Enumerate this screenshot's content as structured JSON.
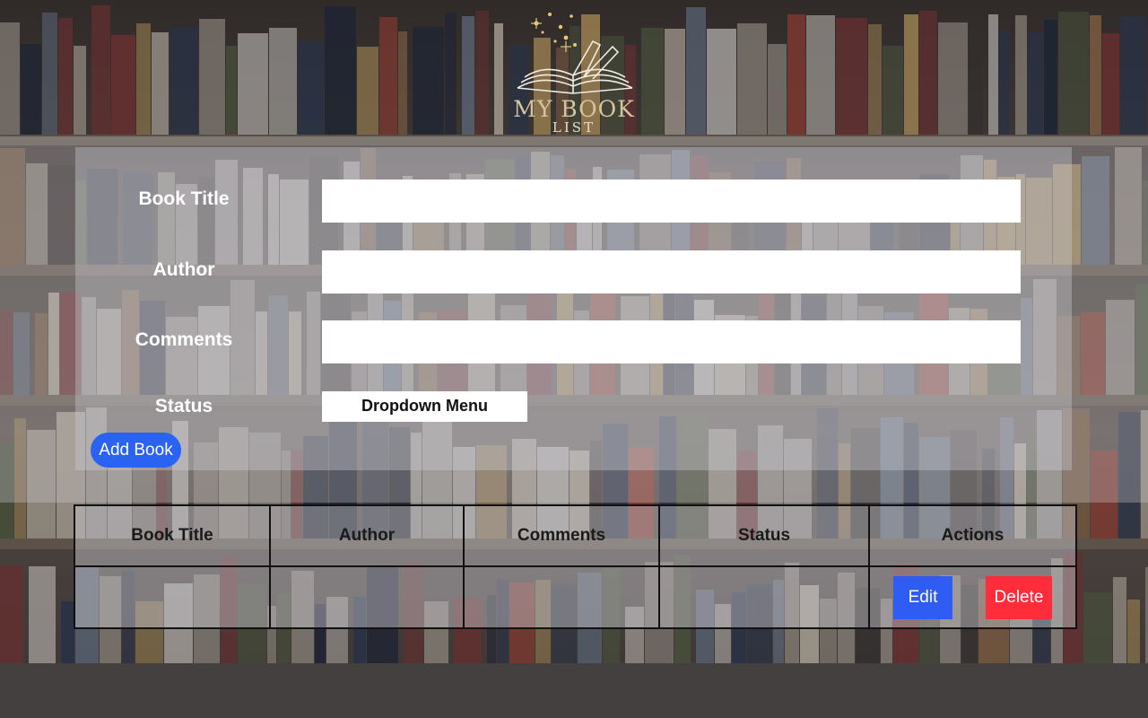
{
  "logo": {
    "line1": "MY BOOK",
    "line2": "LIST"
  },
  "form": {
    "title_label": "Book Title",
    "author_label": "Author",
    "comments_label": "Comments",
    "status_label": "Status",
    "title_value": "",
    "author_value": "",
    "comments_value": "",
    "status_dropdown": "Dropdown Menu",
    "add_button": "Add Book"
  },
  "table": {
    "headers": [
      "Book Title",
      "Author",
      "Comments",
      "Status",
      "Actions"
    ],
    "row": {
      "title": "",
      "author": "",
      "comments": "",
      "status": "",
      "edit_label": "Edit",
      "delete_label": "Delete"
    }
  },
  "colors": {
    "add_button": "#2a62f2",
    "edit_button": "#2f5df4",
    "delete_button": "#ff2d3a",
    "logo_gold": "#d5c49e"
  }
}
